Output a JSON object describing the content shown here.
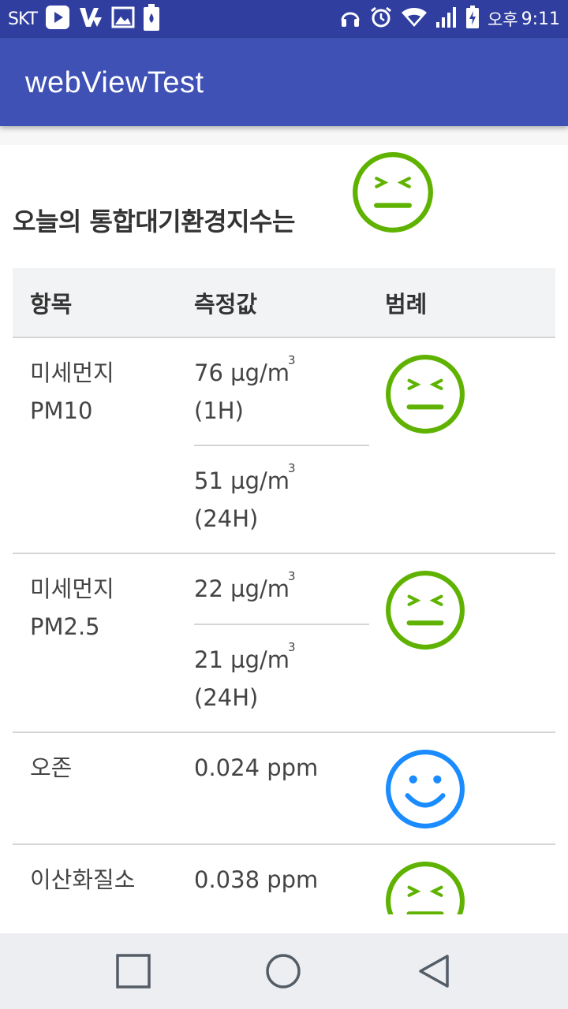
{
  "status_bar": {
    "carrier": "SKT",
    "ampm": "오후",
    "time": "9:11",
    "icons": [
      "play-store-icon",
      "v3-icon",
      "gallery-icon",
      "battery-saver-icon",
      "headset-icon",
      "alarm-icon",
      "wifi-icon",
      "signal-icon",
      "battery-charging-icon"
    ]
  },
  "app_bar": {
    "title": "webViewTest"
  },
  "page": {
    "heading": "오늘의 통합대기환경지수는",
    "heading_face": "neutral-face-icon",
    "table": {
      "headers": [
        "항목",
        "측정값",
        "범례"
      ],
      "rows": [
        {
          "item_line1": "미세먼지",
          "item_line2": "PM10",
          "values": [
            {
              "value": "76 µg/m",
              "sup": "3",
              "period": "(1H)"
            },
            {
              "value": "51 µg/m",
              "sup": "3",
              "period": "(24H)"
            }
          ],
          "face": "neutral-face-icon"
        },
        {
          "item_line1": "미세먼지",
          "item_line2": "PM2.5",
          "values": [
            {
              "value": "22 µg/m",
              "sup": "3",
              "period": ""
            },
            {
              "value": "21 µg/m",
              "sup": "3",
              "period": "(24H)"
            }
          ],
          "face": "neutral-face-icon"
        },
        {
          "item_line1": "오존",
          "value": "0.024 ppm",
          "face": "smile-face-icon"
        },
        {
          "item_line1": "이산화질소",
          "value": "0.038 ppm",
          "face": "neutral-face-icon"
        }
      ]
    }
  },
  "colors": {
    "status_bar": "#303f9f",
    "app_bar": "#3f51b5",
    "neutral_face": "#5fb300",
    "smile_face": "#1a8cff",
    "table_header_bg": "#f1f3f5",
    "nav_bar": "#eceef2"
  },
  "nav_bar": {
    "buttons": [
      "recent-apps-icon",
      "home-icon",
      "back-icon"
    ]
  }
}
